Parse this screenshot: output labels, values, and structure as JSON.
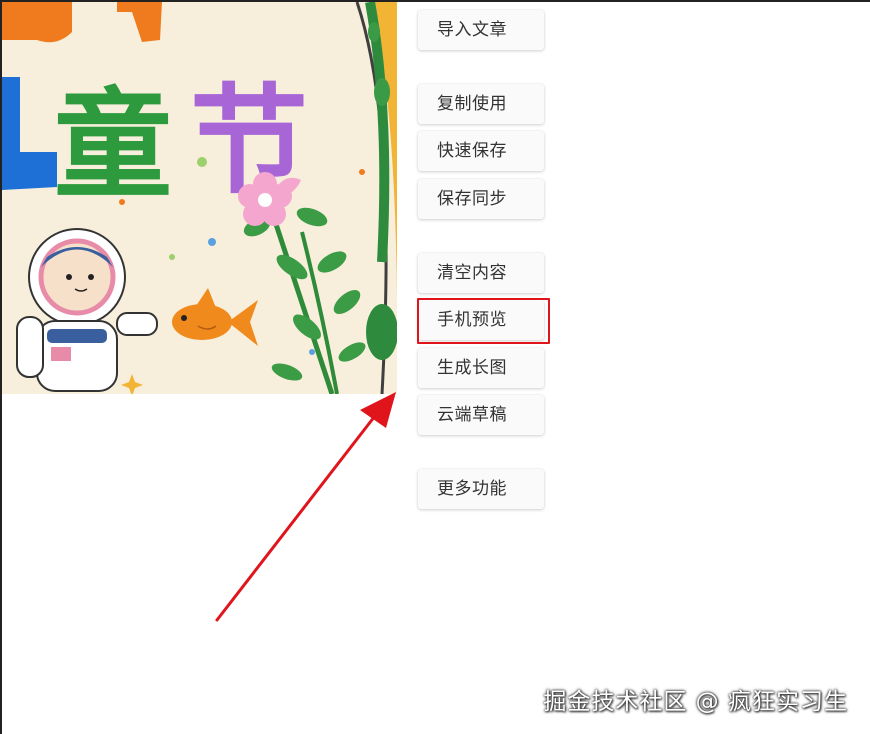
{
  "poster": {
    "title_chars": [
      "童",
      "节"
    ]
  },
  "toolbar": {
    "groups": [
      [
        {
          "label": "导入文章"
        }
      ],
      [
        {
          "label": "复制使用"
        },
        {
          "label": "快速保存"
        },
        {
          "label": "保存同步"
        }
      ],
      [
        {
          "label": "清空内容"
        },
        {
          "label": "手机预览"
        },
        {
          "label": "生成长图"
        },
        {
          "label": "云端草稿"
        }
      ],
      [
        {
          "label": "更多功能"
        }
      ]
    ]
  },
  "highlighted_button": "手机预览",
  "annotation": {
    "highlight_color": "#e0151c",
    "arrow_color": "#e0151c"
  },
  "watermark": "掘金技术社区 @ 疯狂实习生"
}
